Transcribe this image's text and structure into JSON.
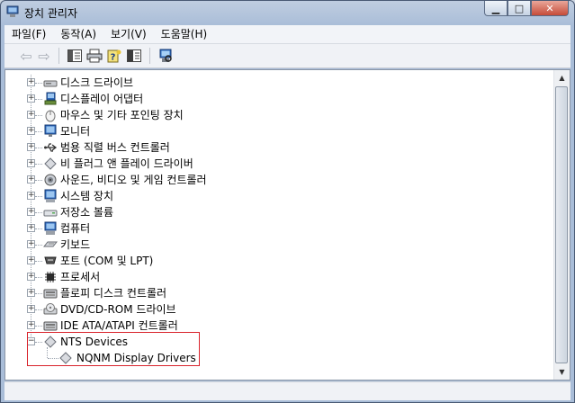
{
  "window": {
    "title": "장치 관리자"
  },
  "menu": [
    "파일(F)",
    "동작(A)",
    "보기(V)",
    "도움말(H)"
  ],
  "toolbar": {
    "buttons": [
      "back-arrow-icon",
      "forward-arrow-icon",
      "show-hide-tree-icon",
      "print-icon",
      "help-icon",
      "properties-icon",
      "scan-hardware-icon"
    ]
  },
  "tree": {
    "categories": [
      {
        "label": "디스크 드라이브",
        "icon": "disk-drive-icon"
      },
      {
        "label": "디스플레이 어댑터",
        "icon": "display-adapter-icon"
      },
      {
        "label": "마우스 및 기타 포인팅 장치",
        "icon": "mouse-icon"
      },
      {
        "label": "모니터",
        "icon": "monitor-icon"
      },
      {
        "label": "범용 직렬 버스 컨트롤러",
        "icon": "usb-icon"
      },
      {
        "label": "비 플러그 앤 플레이 드라이버",
        "icon": "generic-device-icon"
      },
      {
        "label": "사운드, 비디오 및 게임 컨트롤러",
        "icon": "sound-icon"
      },
      {
        "label": "시스템 장치",
        "icon": "system-device-icon"
      },
      {
        "label": "저장소 볼륨",
        "icon": "storage-volume-icon"
      },
      {
        "label": "컴퓨터",
        "icon": "computer-icon"
      },
      {
        "label": "키보드",
        "icon": "keyboard-icon"
      },
      {
        "label": "포트 (COM 및 LPT)",
        "icon": "port-icon"
      },
      {
        "label": "프로세서",
        "icon": "processor-icon"
      },
      {
        "label": "플로피 디스크 컨트롤러",
        "icon": "controller-icon"
      },
      {
        "label": "DVD/CD-ROM 드라이브",
        "icon": "cdrom-icon"
      },
      {
        "label": "IDE ATA/ATAPI 컨트롤러",
        "icon": "controller-icon"
      }
    ],
    "expanded": {
      "label": "NTS Devices",
      "child": "NQNM Display Drivers"
    }
  }
}
